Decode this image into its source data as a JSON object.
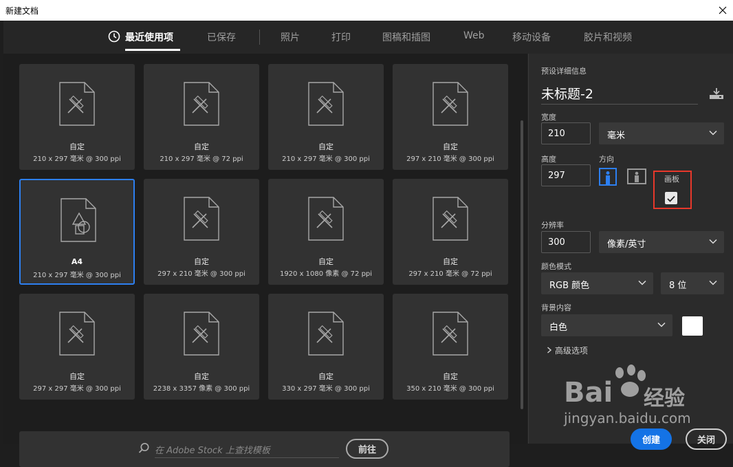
{
  "window": {
    "title": "新建文档"
  },
  "tabs": [
    {
      "label": "最近使用项"
    },
    {
      "label": "已保存"
    },
    {
      "label": "照片"
    },
    {
      "label": "打印"
    },
    {
      "label": "图稿和插图"
    },
    {
      "label": "Web"
    },
    {
      "label": "移动设备"
    },
    {
      "label": "胶片和视频"
    }
  ],
  "presets": [
    {
      "name": "自定",
      "desc": "210 x 297 毫米 @ 300 ppi"
    },
    {
      "name": "自定",
      "desc": "210 x 297 毫米 @ 72 ppi"
    },
    {
      "name": "自定",
      "desc": "210 x 297 毫米 @ 300 ppi"
    },
    {
      "name": "自定",
      "desc": "297 x 210 毫米 @ 300 ppi"
    },
    {
      "name": "A4",
      "desc": "210 x 297 毫米 @ 300 ppi"
    },
    {
      "name": "自定",
      "desc": "297 x 210 毫米 @ 300 ppi"
    },
    {
      "name": "自定",
      "desc": "1920 x 1080 像素 @ 72 ppi"
    },
    {
      "name": "自定",
      "desc": "297 x 210 毫米 @ 72 ppi"
    },
    {
      "name": "自定",
      "desc": "297 x 297 毫米 @ 300 ppi"
    },
    {
      "name": "自定",
      "desc": "2238 x 3357 像素 @ 300 ppi"
    },
    {
      "name": "自定",
      "desc": "330 x 297 毫米 @ 300 ppi"
    },
    {
      "name": "自定",
      "desc": "350 x 210 毫米 @ 300 ppi"
    }
  ],
  "search": {
    "placeholder": "在 Adobe Stock 上查找模板",
    "go_label": "前往"
  },
  "details": {
    "header": "预设详细信息",
    "doc_name": "未标题-2",
    "width_label": "宽度",
    "width_value": "210",
    "width_unit": "毫米",
    "height_label": "高度",
    "height_value": "297",
    "orientation_label": "方向",
    "artboard_label": "画板",
    "resolution_label": "分辨率",
    "resolution_value": "300",
    "resolution_unit": "像素/英寸",
    "color_mode_label": "颜色模式",
    "color_mode_value": "RGB 颜色",
    "bit_depth_value": "8 位",
    "background_label": "背景内容",
    "background_value": "白色",
    "advanced_label": "高级选项"
  },
  "buttons": {
    "create": "创建",
    "close": "关闭"
  },
  "watermark": {
    "line1": "Bai",
    "line2": "经验",
    "url": "jingyan.baidu.com"
  },
  "colors": {
    "accent": "#1473e6",
    "selection": "#2d7ff0",
    "highlight": "#e8382b"
  }
}
